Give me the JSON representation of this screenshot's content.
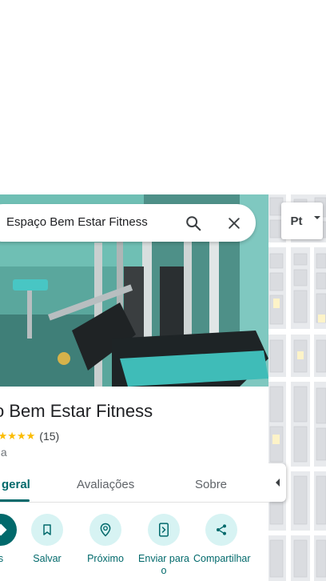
{
  "search": {
    "query": "Espaço Bem Estar Fitness"
  },
  "place": {
    "title": "ço Bem Estar Fitness",
    "stars": "★★★★★",
    "review_count": "(15)",
    "category": "nia",
    "rating_value": 5
  },
  "tabs": [
    {
      "label": "geral",
      "active": true
    },
    {
      "label": "Avaliações",
      "active": false
    },
    {
      "label": "Sobre",
      "active": false
    }
  ],
  "actions": [
    {
      "label": "s",
      "icon": "directions-icon"
    },
    {
      "label": "Salvar",
      "icon": "bookmark-icon"
    },
    {
      "label": "Próximo",
      "icon": "nearby-icon"
    },
    {
      "label": "Enviar para o",
      "icon": "send-to-phone-icon"
    },
    {
      "label": "Compartilhar",
      "icon": "share-icon"
    }
  ],
  "map": {
    "layer_label": "Pt"
  },
  "colors": {
    "accent": "#01696b",
    "accent_light": "#d7f3f3",
    "star": "#fbbc04"
  }
}
